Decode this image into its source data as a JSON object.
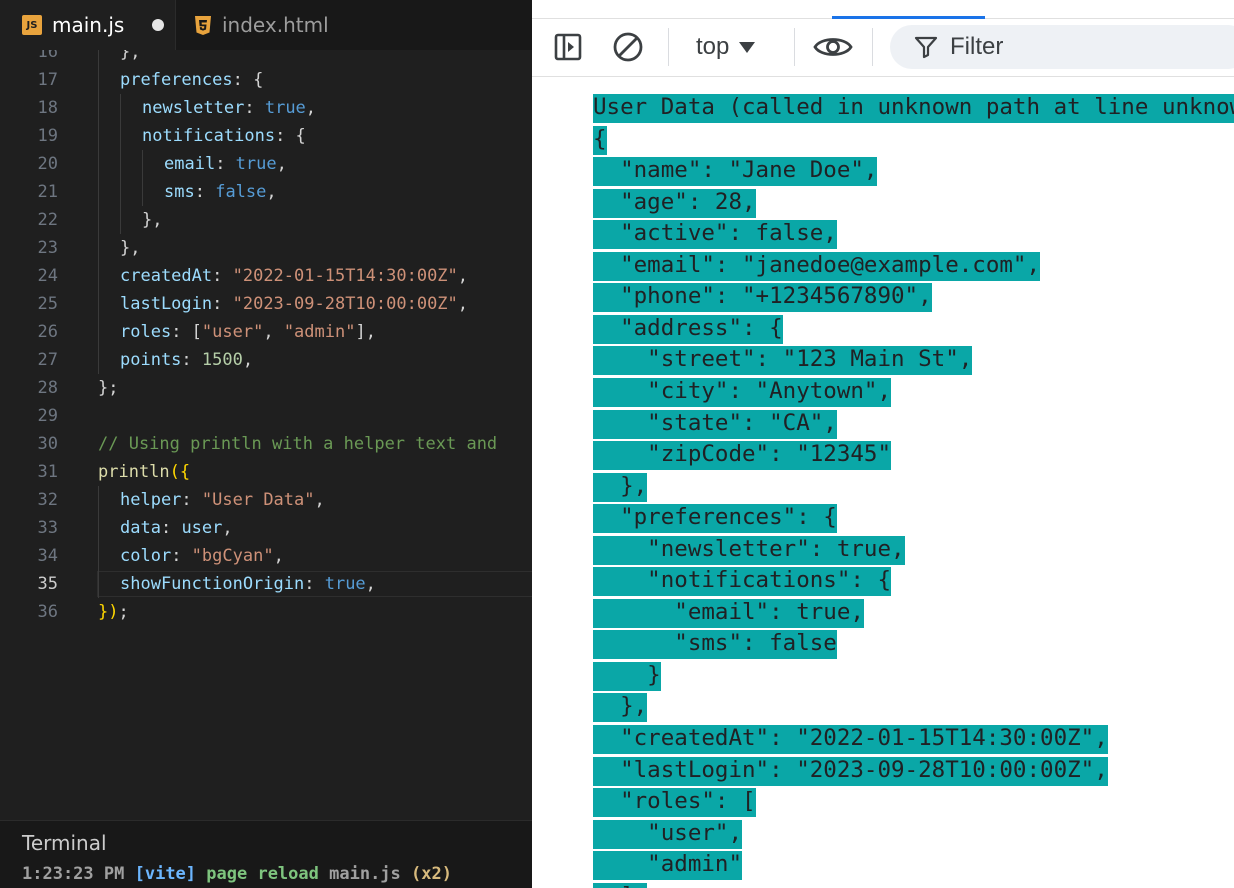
{
  "editor": {
    "tabs": [
      {
        "label": "main.js",
        "icon": "js-file-icon",
        "active": true,
        "unsaved": true
      },
      {
        "label": "index.html",
        "icon": "html5-file-icon",
        "active": false,
        "unsaved": false
      }
    ],
    "first_line_number": 16,
    "current_line": 35,
    "code_lines": [
      [
        [
          "p",
          "},"
        ]
      ],
      [
        [
          "k",
          "preferences"
        ],
        [
          "p",
          ": {"
        ]
      ],
      [
        [
          "k",
          "newsletter"
        ],
        [
          "p",
          ": "
        ],
        [
          "b",
          "true"
        ],
        [
          "p",
          ","
        ]
      ],
      [
        [
          "k",
          "notifications"
        ],
        [
          "p",
          ": {"
        ]
      ],
      [
        [
          "k",
          "email"
        ],
        [
          "p",
          ": "
        ],
        [
          "b",
          "true"
        ],
        [
          "p",
          ","
        ]
      ],
      [
        [
          "k",
          "sms"
        ],
        [
          "p",
          ": "
        ],
        [
          "b",
          "false"
        ],
        [
          "p",
          ","
        ]
      ],
      [
        [
          "p",
          "},"
        ]
      ],
      [
        [
          "p",
          "},"
        ]
      ],
      [
        [
          "k",
          "createdAt"
        ],
        [
          "p",
          ": "
        ],
        [
          "s",
          "\"2022-01-15T14:30:00Z\""
        ],
        [
          "p",
          ","
        ]
      ],
      [
        [
          "k",
          "lastLogin"
        ],
        [
          "p",
          ": "
        ],
        [
          "s",
          "\"2023-09-28T10:00:00Z\""
        ],
        [
          "p",
          ","
        ]
      ],
      [
        [
          "k",
          "roles"
        ],
        [
          "p",
          ": ["
        ],
        [
          "s",
          "\"user\""
        ],
        [
          "p",
          ", "
        ],
        [
          "s",
          "\"admin\""
        ],
        [
          "p",
          "],"
        ]
      ],
      [
        [
          "k",
          "points"
        ],
        [
          "p",
          ": "
        ],
        [
          "n",
          "1500"
        ],
        [
          "p",
          ","
        ]
      ],
      [
        [
          "p",
          "};"
        ]
      ],
      [],
      [
        [
          "c",
          "// Using println with a helper text and"
        ]
      ],
      [
        [
          "f",
          "println"
        ],
        [
          "y",
          "({"
        ]
      ],
      [
        [
          "k",
          "helper"
        ],
        [
          "p",
          ": "
        ],
        [
          "s",
          "\"User Data\""
        ],
        [
          "p",
          ","
        ]
      ],
      [
        [
          "k",
          "data"
        ],
        [
          "p",
          ": "
        ],
        [
          "k",
          "user"
        ],
        [
          "p",
          ","
        ]
      ],
      [
        [
          "k",
          "color"
        ],
        [
          "p",
          ": "
        ],
        [
          "s",
          "\"bgCyan\""
        ],
        [
          "p",
          ","
        ]
      ],
      [
        [
          "k",
          "showFunctionOrigin"
        ],
        [
          "p",
          ": "
        ],
        [
          "b",
          "true"
        ],
        [
          "p",
          ","
        ]
      ],
      [
        [
          "y",
          "})"
        ],
        [
          "p",
          ";"
        ]
      ]
    ],
    "code_indents": [
      1,
      1,
      2,
      2,
      3,
      3,
      2,
      1,
      1,
      1,
      1,
      1,
      0,
      0,
      0,
      0,
      1,
      1,
      1,
      1,
      0
    ]
  },
  "terminal": {
    "title": "Terminal",
    "log": {
      "time": "1:23:23 PM",
      "tag": "[vite]",
      "message": "page reload",
      "file": "main.js",
      "count": "(x2)"
    }
  },
  "devtools": {
    "toolbar": {
      "sidebar_icon": "show-sidebar-icon",
      "clear_icon": "clear-console-icon",
      "context": "top",
      "live_expression_icon": "eye-icon",
      "filter_placeholder": "Filter"
    },
    "console_lines": [
      "User Data (called in unknown path at line unknown)",
      "{",
      "  \"name\": \"Jane Doe\",",
      "  \"age\": 28,",
      "  \"active\": false,",
      "  \"email\": \"janedoe@example.com\",",
      "  \"phone\": \"+1234567890\",",
      "  \"address\": {",
      "    \"street\": \"123 Main St\",",
      "    \"city\": \"Anytown\",",
      "    \"state\": \"CA\",",
      "    \"zipCode\": \"12345\"",
      "  },",
      "  \"preferences\": {",
      "    \"newsletter\": true,",
      "    \"notifications\": {",
      "      \"email\": true,",
      "      \"sms\": false",
      "    }",
      "  },",
      "  \"createdAt\": \"2022-01-15T14:30:00Z\",",
      "  \"lastLogin\": \"2023-09-28T10:00:00Z\",",
      "  \"roles\": [",
      "    \"user\",",
      "    \"admin\"",
      "  ],"
    ],
    "highlight_color": "#0aa7a7"
  },
  "colors": {
    "editor_bg": "#1f1f1f",
    "accent": "#1a73e8",
    "console_highlight": "#0aa7a7"
  }
}
